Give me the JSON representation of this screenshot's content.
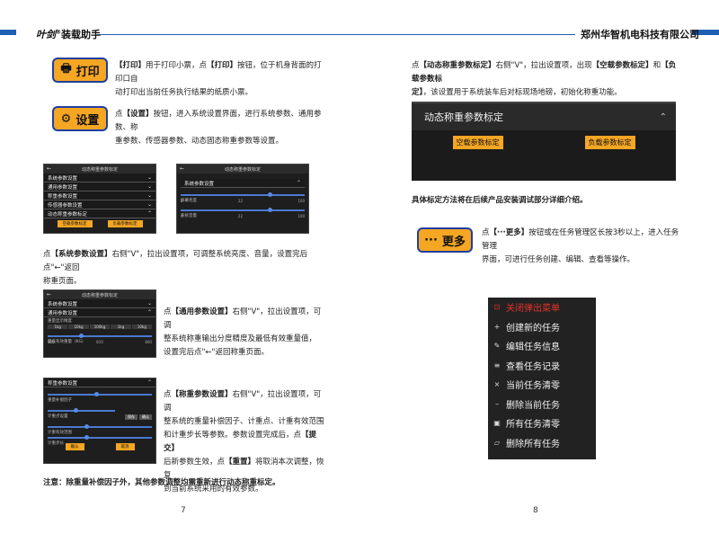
{
  "header": {
    "brand_logo": "叶剑",
    "brand_sup": "®",
    "app_name": "装载助手",
    "company": "郑州华智机电科技有限公司"
  },
  "left": {
    "print_btn": "打印",
    "print_desc_b": "【打印】",
    "print_desc_1": "用于打印小票，点",
    "print_desc_b2": "【打印】",
    "print_desc_2": "按钮，位于机身背面的打印口自",
    "print_desc_3": "动打印出当前任务执行结果的纸质小票。",
    "settings_btn": "设置",
    "settings_desc_1": "点",
    "settings_desc_b": "【设置】",
    "settings_desc_2": "按钮，进入系统设置界面，进行系统参数、通用参数、称",
    "settings_desc_3": "重参数、传感器参数、动态固态称重参数等设置。",
    "shot1": {
      "title": "动态称重参数标定",
      "rows": [
        "系统参数设置",
        "通用参数设置",
        "称重参数设置",
        "传感器参数设置",
        "动态称重参数标定"
      ],
      "btn1": "空载参数标定",
      "btn2": "负载参数标定"
    },
    "shot2": {
      "title": "动态称重参数标定",
      "row": "系统参数设置",
      "s1": "屏幕亮度",
      "s2": "系统音量",
      "t0": "0",
      "t1": "22",
      "t2": "100"
    },
    "sys_desc_1": "点",
    "sys_desc_b": "【系统参数设置】",
    "sys_desc_2": "右侧\"V\"，拉出设置项，可调整系统亮度、音量，设置完后点\"←\"返回",
    "sys_desc_3": "称重页面。",
    "shot3": {
      "title": "动态称重参数标定",
      "rows": [
        "系统参数设置",
        "通用参数设置"
      ],
      "sub1": "重量显示精度",
      "opts": [
        "1kg",
        "10kg",
        "100kg",
        "1kg",
        "10kg"
      ],
      "sub2": "最低有效重量（KG）",
      "t0": "100",
      "t1": "810",
      "t2": "800"
    },
    "gen_desc_1": "点",
    "gen_desc_b": "【通用参数设置】",
    "gen_desc_2": "右侧\"V\"，拉出设置项，可调",
    "gen_desc_3": "整系统称重输出分度精度及最低有效重量值，",
    "gen_desc_4": "设置完后点\"←\"返回称重页面。",
    "shot4": {
      "row": "称重参数设置",
      "s1": "重量补偿因子",
      "s2": "计重点设置",
      "s3": "计重有效范围",
      "s4": "计重步长",
      "btn_save": "保存",
      "btn_submit": "确认",
      "btn_ok": "确认",
      "btn_cancel": "取消"
    },
    "wt_desc_1": "点",
    "wt_desc_b": "【称重参数设置】",
    "wt_desc_2": "右侧\"V\"，拉出设置项，可调",
    "wt_desc_3": "整系统的重量补偿因子、计重点、计重有效范围",
    "wt_desc_4": "和计重步长等参数。参数设置完成后，点",
    "wt_desc_b2": "【提交】",
    "wt_desc_5": "后新参数生效，点",
    "wt_desc_b3": "【重置】",
    "wt_desc_6": "将取消本次调整，恢复",
    "wt_desc_7": "到当前系统采用的有效参数。",
    "note": "注意：除重量补偿因子外，其他参数调整均需重新进行动态称重标定。",
    "page": "7"
  },
  "right": {
    "dyn_desc_1": "点",
    "dyn_desc_b": "【动态称重参数标定】",
    "dyn_desc_2": "右侧\"V\"，拉出设置项，出现",
    "dyn_desc_b2": "【空载参数标定】",
    "dyn_desc_3": "和",
    "dyn_desc_b3": "【负载参数标",
    "dyn_desc_b4": "定】",
    "dyn_desc_4": "，该设置用于系统装车后对标现场地磅，初始化称重功能。",
    "panel_title": "动态称重参数标定",
    "panel_btn1": "空载参数标定",
    "panel_btn2": "负载参数标定",
    "calib_note": "具体标定方法将在后续产品安装调试部分详细介绍。",
    "more_btn": "更多",
    "more_desc_1": "点",
    "more_desc_b": "【···更多】",
    "more_desc_2": "按钮或在任务管理区长按3秒以上，进入任务管理",
    "more_desc_3": "界面，可进行任务创建、编辑、查看等操作。",
    "menu": [
      {
        "icon": "⊡",
        "label": "关闭弹出菜单"
      },
      {
        "icon": "+",
        "label": "创建新的任务"
      },
      {
        "icon": "✎",
        "label": "编辑任务信息"
      },
      {
        "icon": "≡",
        "label": "查看任务记录"
      },
      {
        "icon": "×",
        "label": "当前任务清零"
      },
      {
        "icon": "–",
        "label": "删除当前任务"
      },
      {
        "icon": "▣",
        "label": "所有任务清零"
      },
      {
        "icon": "▱",
        "label": "删除所有任务"
      }
    ],
    "page": "8"
  },
  "colors": {
    "accent_blue": "#1f5fb4",
    "button_orange": "#f5a623",
    "menu_red": "#e8312a"
  }
}
